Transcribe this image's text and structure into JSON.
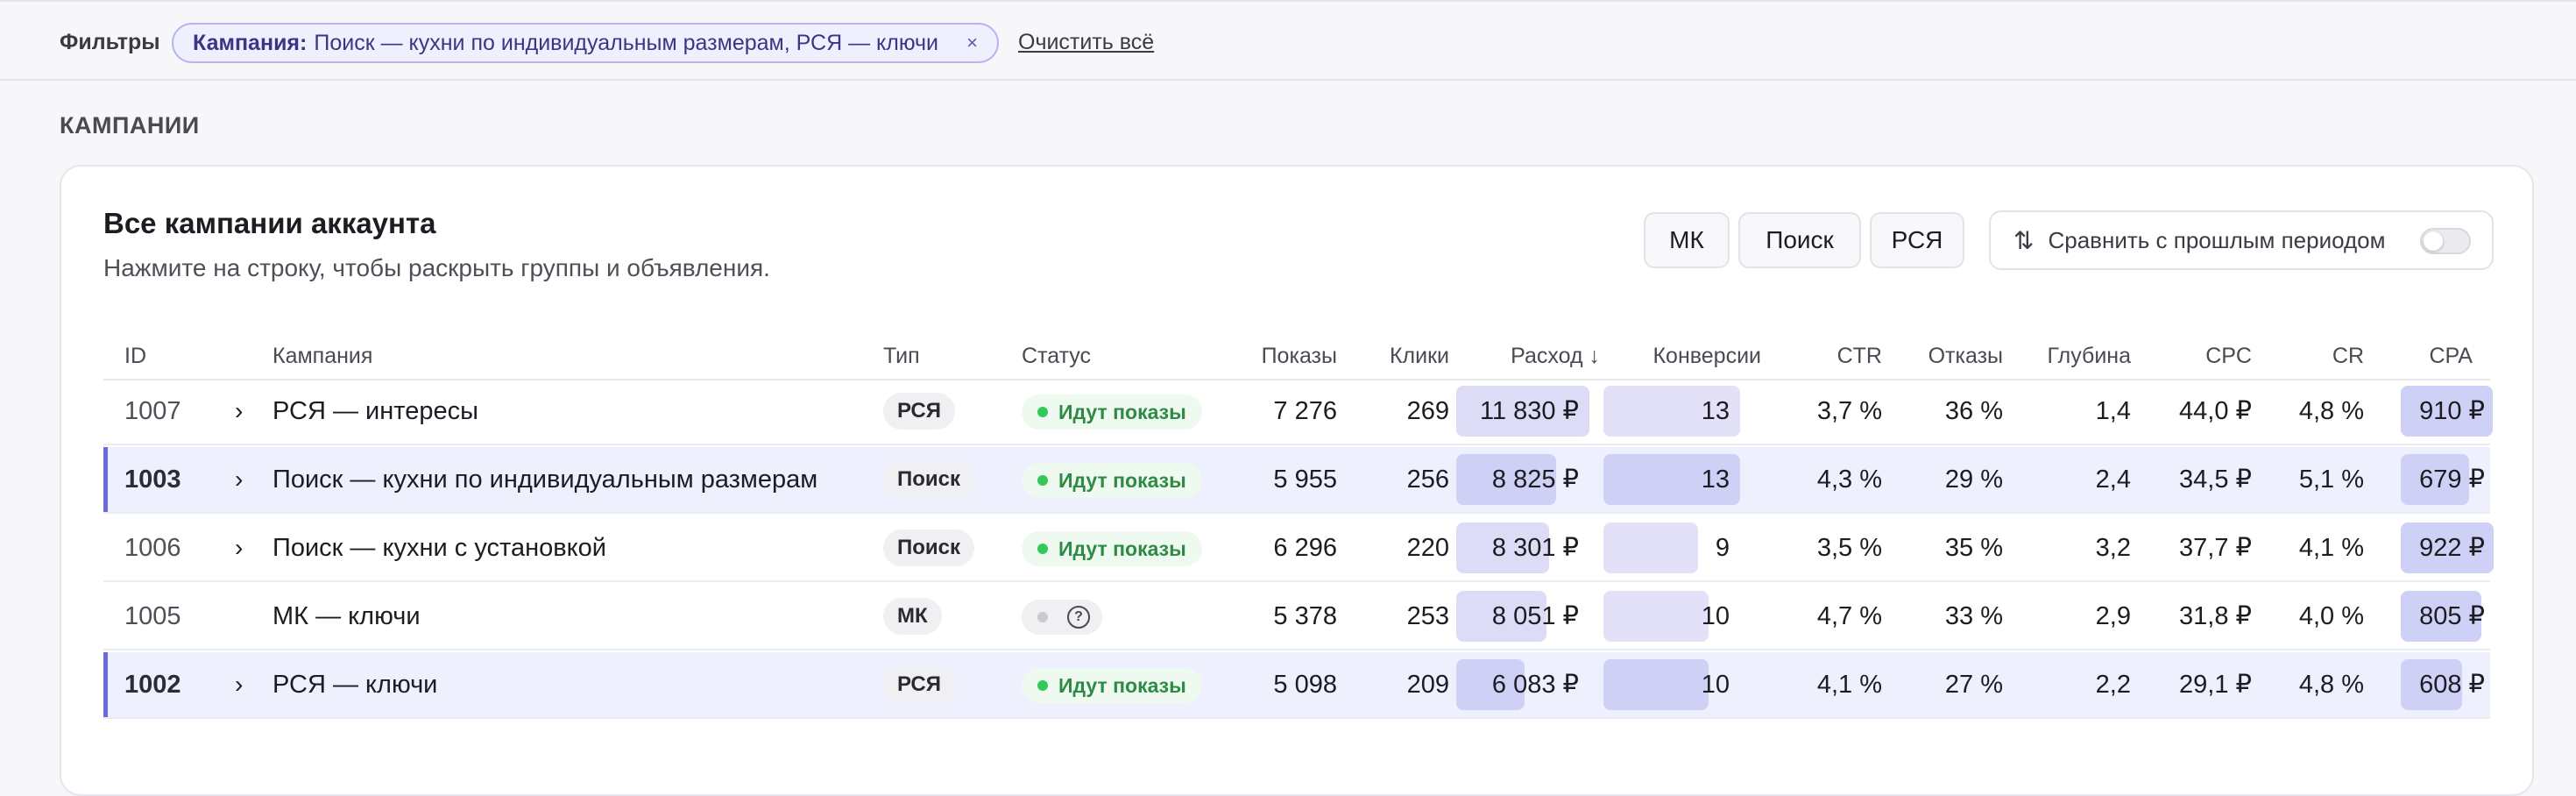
{
  "filters": {
    "label": "Фильтры",
    "chip_key": "Кампания:",
    "chip_value": "Поиск — кухни по индивидуальным размерам, РСЯ — ключи",
    "chip_close": "×",
    "clear_all": "Очистить всё"
  },
  "section_title": "КАМПАНИИ",
  "card": {
    "title": "Все кампании аккаунта",
    "subtitle": "Нажмите на строку, чтобы раскрыть группы и объявления.",
    "segments": [
      "МК",
      "Поиск",
      "РСЯ"
    ],
    "compare_icon": "sort-arrows-icon",
    "compare_label": "Сравнить с прошлым периодом",
    "compare_enabled": false
  },
  "columns": {
    "id": "ID",
    "campaign": "Кампания",
    "type": "Тип",
    "status": "Статус",
    "impressions": "Показы",
    "clicks": "Клики",
    "spend": "Расход ↓",
    "conversions": "Конверсии",
    "ctr": "CTR",
    "bounces": "Отказы",
    "depth": "Глубина",
    "cpc": "CPC",
    "cr": "CR",
    "cpa": "CPA"
  },
  "rows": [
    {
      "id": "1007",
      "expand": "›",
      "name": "РСЯ — интересы",
      "type": "РСЯ",
      "status": "Идут показы",
      "impressions": "7 276",
      "clicks": "269",
      "spend": "11 830 ₽",
      "conversions": "13",
      "ctr": "3,7 %",
      "bounces": "36 %",
      "depth": "1,4",
      "cpc": "44,0 ₽",
      "cr": "4,8 %",
      "cpa": "910 ₽",
      "selected": false,
      "spend_share": 1.0,
      "conv_share": 1.0,
      "cpa_share": 0.99
    },
    {
      "id": "1003",
      "expand": "›",
      "name": "Поиск — кухни по индивидуальным размерам",
      "type": "Поиск",
      "status": "Идут показы",
      "impressions": "5 955",
      "clicks": "256",
      "spend": "8 825 ₽",
      "conversions": "13",
      "ctr": "4,3 %",
      "bounces": "29 %",
      "depth": "2,4",
      "cpc": "34,5 ₽",
      "cr": "5,1 %",
      "cpa": "679 ₽",
      "selected": true,
      "spend_share": 0.75,
      "conv_share": 1.0,
      "cpa_share": 0.74
    },
    {
      "id": "1006",
      "expand": "›",
      "name": "Поиск — кухни с установкой",
      "type": "Поиск",
      "status": "Идут показы",
      "impressions": "6 296",
      "clicks": "220",
      "spend": "8 301 ₽",
      "conversions": "9",
      "ctr": "3,5 %",
      "bounces": "35 %",
      "depth": "3,2",
      "cpc": "37,7 ₽",
      "cr": "4,1 %",
      "cpa": "922 ₽",
      "selected": false,
      "spend_share": 0.7,
      "conv_share": 0.69,
      "cpa_share": 1.0
    },
    {
      "id": "1005",
      "expand": "",
      "name": "МК — ключи",
      "type": "МК",
      "status": "",
      "impressions": "5 378",
      "clicks": "253",
      "spend": "8 051 ₽",
      "conversions": "10",
      "ctr": "4,7 %",
      "bounces": "33 %",
      "depth": "2,9",
      "cpc": "31,8 ₽",
      "cr": "4,0 %",
      "cpa": "805 ₽",
      "selected": false,
      "spend_share": 0.68,
      "conv_share": 0.77,
      "cpa_share": 0.87
    },
    {
      "id": "1002",
      "expand": "›",
      "name": "РСЯ — ключи",
      "type": "РСЯ",
      "status": "Идут показы",
      "impressions": "5 098",
      "clicks": "209",
      "spend": "6 083 ₽",
      "conversions": "10",
      "ctr": "4,1 %",
      "bounces": "27 %",
      "depth": "2,2",
      "cpc": "29,1 ₽",
      "cr": "4,8 %",
      "cpa": "608 ₽",
      "selected": true,
      "spend_share": 0.51,
      "conv_share": 0.77,
      "cpa_share": 0.66
    }
  ],
  "colors": {
    "accent": "#6b68e0",
    "bar_spend": "#dcdcf7",
    "bar_spend_sel": "#cfd0f5",
    "bar_conv": "#e2e1f8",
    "status_green": "#34c759"
  }
}
